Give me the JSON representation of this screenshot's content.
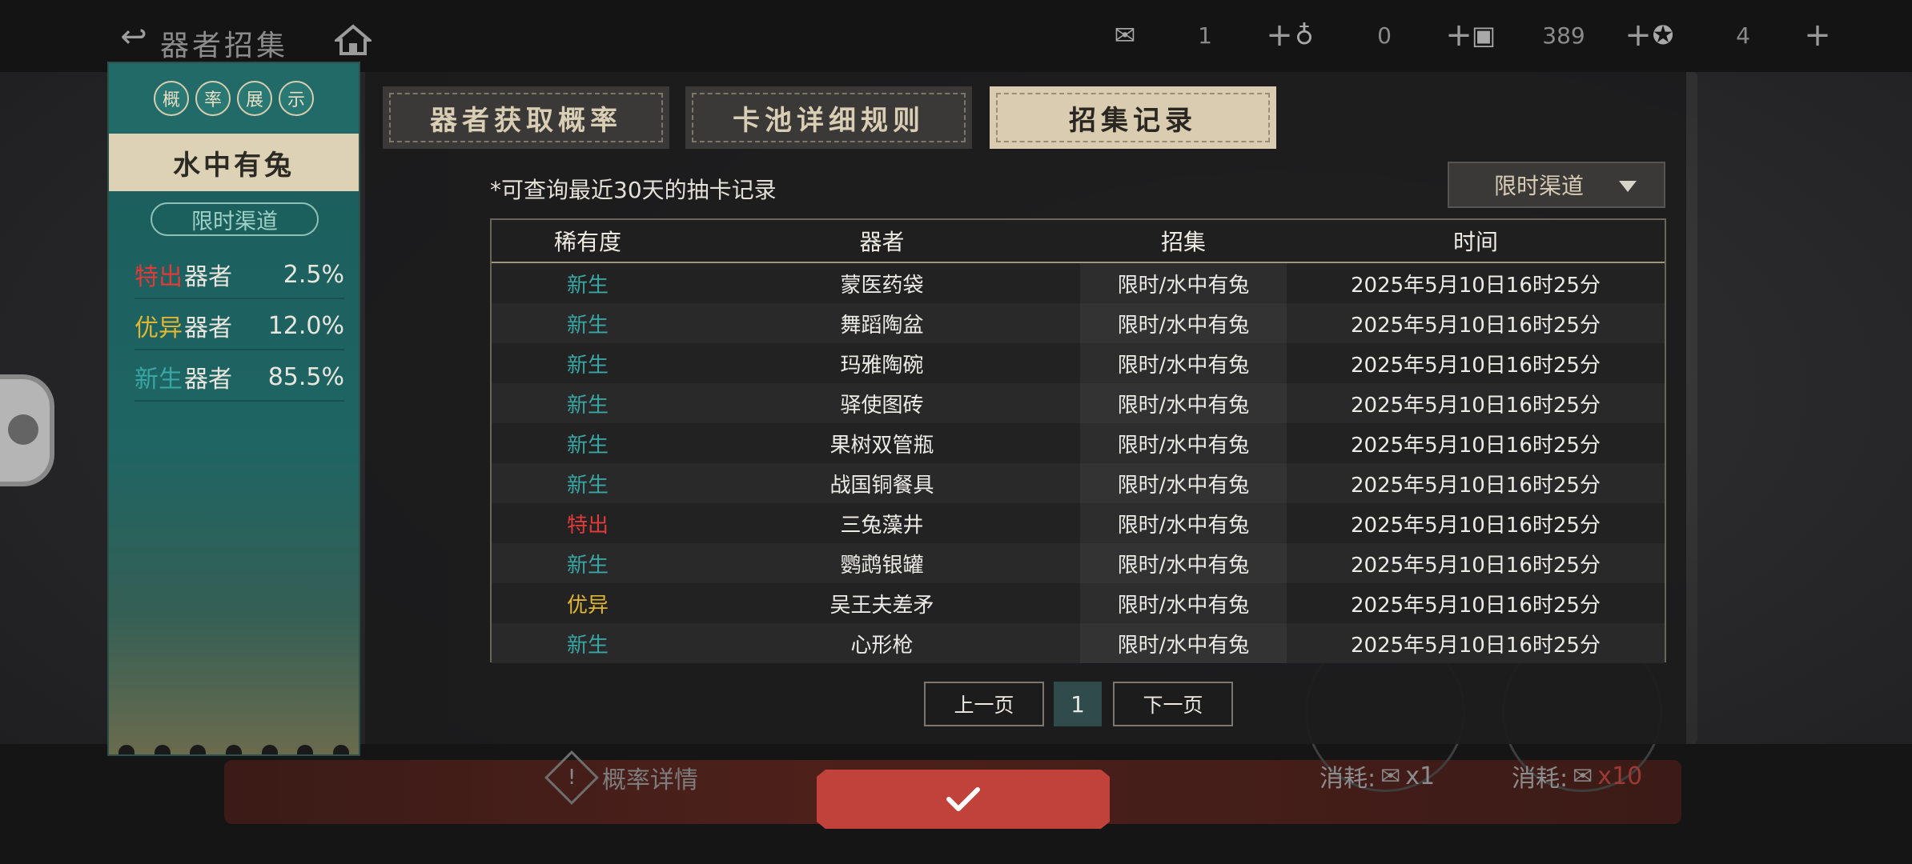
{
  "topbar": {
    "title": "器者招集",
    "resources": [
      {
        "icon": "envelope-ticket-icon",
        "value": "1"
      },
      {
        "icon": "gourd-token-icon",
        "value": "0"
      },
      {
        "icon": "tablet-currency-icon",
        "value": "389"
      },
      {
        "icon": "star-medal-icon",
        "value": "4"
      }
    ]
  },
  "left_panel": {
    "header_chars": [
      "概",
      "率",
      "展",
      "示"
    ],
    "pool_name": "水中有兔",
    "channel": "限时渠道",
    "rates": [
      {
        "tier": "特出",
        "suffix": "器者",
        "percent": "2.5%",
        "color": "#e23a38"
      },
      {
        "tier": "优异",
        "suffix": "器者",
        "percent": "12.0%",
        "color": "#e2b632"
      },
      {
        "tier": "新生",
        "suffix": "器者",
        "percent": "85.5%",
        "color": "#3aa6a4"
      }
    ]
  },
  "tabs": [
    {
      "label": "器者获取概率",
      "active": false
    },
    {
      "label": "卡池详细规则",
      "active": false
    },
    {
      "label": "招集记录",
      "active": true
    }
  ],
  "records": {
    "note": "*可查询最近30天的抽卡记录",
    "channel_select": "限时渠道",
    "columns": [
      "稀有度",
      "器者",
      "招集",
      "时间"
    ],
    "rows": [
      {
        "rarity": "新生",
        "rarity_class": "rar-common",
        "item": "蒙医药袋",
        "recruit": "限时/水中有兔",
        "time": "2025年5月10日16时25分"
      },
      {
        "rarity": "新生",
        "rarity_class": "rar-common",
        "item": "舞蹈陶盆",
        "recruit": "限时/水中有兔",
        "time": "2025年5月10日16时25分"
      },
      {
        "rarity": "新生",
        "rarity_class": "rar-common",
        "item": "玛雅陶碗",
        "recruit": "限时/水中有兔",
        "time": "2025年5月10日16时25分"
      },
      {
        "rarity": "新生",
        "rarity_class": "rar-common",
        "item": "驿使图砖",
        "recruit": "限时/水中有兔",
        "time": "2025年5月10日16时25分"
      },
      {
        "rarity": "新生",
        "rarity_class": "rar-common",
        "item": "果树双管瓶",
        "recruit": "限时/水中有兔",
        "time": "2025年5月10日16时25分"
      },
      {
        "rarity": "新生",
        "rarity_class": "rar-common",
        "item": "战国铜餐具",
        "recruit": "限时/水中有兔",
        "time": "2025年5月10日16时25分"
      },
      {
        "rarity": "特出",
        "rarity_class": "rar-special",
        "item": "三兔藻井",
        "recruit": "限时/水中有兔",
        "time": "2025年5月10日16时25分"
      },
      {
        "rarity": "新生",
        "rarity_class": "rar-common",
        "item": "鹦鹉银罐",
        "recruit": "限时/水中有兔",
        "time": "2025年5月10日16时25分"
      },
      {
        "rarity": "优异",
        "rarity_class": "rar-excellent",
        "item": "吴王夫差矛",
        "recruit": "限时/水中有兔",
        "time": "2025年5月10日16时25分"
      },
      {
        "rarity": "新生",
        "rarity_class": "rar-common",
        "item": "心形枪",
        "recruit": "限时/水中有兔",
        "time": "2025年5月10日16时25分"
      }
    ]
  },
  "pager": {
    "prev": "上一页",
    "page": "1",
    "next": "下一页"
  },
  "bottom": {
    "prob_detail": "概率详情",
    "cost_label": "消耗:",
    "cost_single": "x1",
    "cost_ten": "x10"
  },
  "colors": {
    "accent_teal": "#1e6563",
    "confirm_red": "#c1423a",
    "tab_active": "#d9ccb0"
  }
}
